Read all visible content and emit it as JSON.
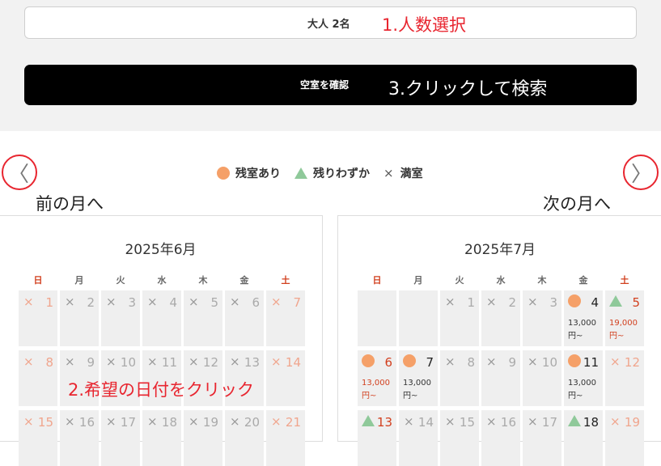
{
  "search": {
    "guests_label": "大人 2名",
    "confirm_label": "空室を確認"
  },
  "annotations": {
    "step1": "1.人数選択",
    "step2": "2.希望の日付をクリック",
    "step3": "3.クリックして検索",
    "prev_month": "前の月へ",
    "next_month": "次の月へ"
  },
  "nav": {
    "prev_icon": "chevron-left-icon",
    "next_icon": "chevron-right-icon",
    "prev_glyph": "〈",
    "next_glyph": "〉"
  },
  "legend": {
    "available": "残室あり",
    "few_left": "残りわずか",
    "full": "満室",
    "full_mark": "×"
  },
  "weekdays": [
    "日",
    "月",
    "火",
    "水",
    "木",
    "金",
    "土"
  ],
  "calendars": [
    {
      "title": "2025年6月",
      "weeks": [
        [
          {
            "day": "1",
            "status": "full"
          },
          {
            "day": "2",
            "status": "full"
          },
          {
            "day": "3",
            "status": "full"
          },
          {
            "day": "4",
            "status": "full"
          },
          {
            "day": "5",
            "status": "full"
          },
          {
            "day": "6",
            "status": "full"
          },
          {
            "day": "7",
            "status": "full"
          }
        ],
        [
          {
            "day": "8",
            "status": "full"
          },
          {
            "day": "9",
            "status": "full"
          },
          {
            "day": "10",
            "status": "full"
          },
          {
            "day": "11",
            "status": "full"
          },
          {
            "day": "12",
            "status": "full"
          },
          {
            "day": "13",
            "status": "full"
          },
          {
            "day": "14",
            "status": "full"
          }
        ],
        [
          {
            "day": "15",
            "status": "full"
          },
          {
            "day": "16",
            "status": "full"
          },
          {
            "day": "17",
            "status": "full"
          },
          {
            "day": "18",
            "status": "full"
          },
          {
            "day": "19",
            "status": "full"
          },
          {
            "day": "20",
            "status": "full"
          },
          {
            "day": "21",
            "status": "full"
          }
        ]
      ]
    },
    {
      "title": "2025年7月",
      "weeks": [
        [
          {
            "day": "",
            "status": "empty"
          },
          {
            "day": "",
            "status": "empty"
          },
          {
            "day": "1",
            "status": "full"
          },
          {
            "day": "2",
            "status": "full"
          },
          {
            "day": "3",
            "status": "full"
          },
          {
            "day": "4",
            "status": "available",
            "price": "13,000",
            "unit": "円~"
          },
          {
            "day": "5",
            "status": "few",
            "price": "19,000",
            "unit": "円~"
          }
        ],
        [
          {
            "day": "6",
            "status": "available",
            "price": "13,000",
            "unit": "円~"
          },
          {
            "day": "7",
            "status": "available",
            "price": "13,000",
            "unit": "円~"
          },
          {
            "day": "8",
            "status": "full"
          },
          {
            "day": "9",
            "status": "full"
          },
          {
            "day": "10",
            "status": "full"
          },
          {
            "day": "11",
            "status": "available",
            "price": "13,000",
            "unit": "円~"
          },
          {
            "day": "12",
            "status": "full"
          }
        ],
        [
          {
            "day": "13",
            "status": "few"
          },
          {
            "day": "14",
            "status": "full"
          },
          {
            "day": "15",
            "status": "full"
          },
          {
            "day": "16",
            "status": "full"
          },
          {
            "day": "17",
            "status": "full"
          },
          {
            "day": "18",
            "status": "few"
          },
          {
            "day": "19",
            "status": "full"
          }
        ]
      ]
    }
  ]
}
